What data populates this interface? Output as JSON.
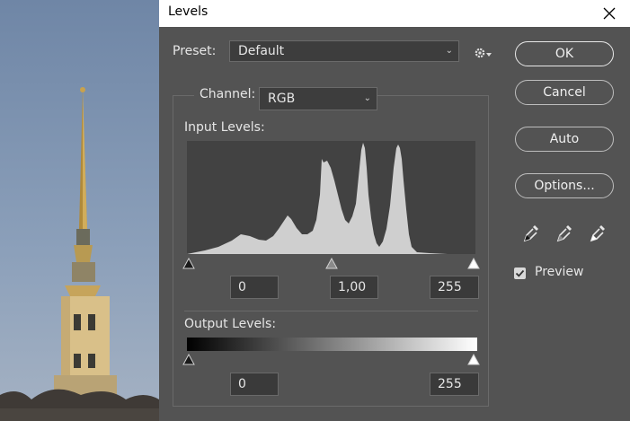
{
  "window": {
    "title": "Levels"
  },
  "preset": {
    "label": "Preset:",
    "value": "Default"
  },
  "channel": {
    "label": "Channel:",
    "value": "RGB"
  },
  "input_levels": {
    "label": "Input Levels:",
    "black": "0",
    "gamma": "1,00",
    "white": "255"
  },
  "output_levels": {
    "label": "Output Levels:",
    "black": "0",
    "white": "255"
  },
  "buttons": {
    "ok": "OK",
    "cancel": "Cancel",
    "auto": "Auto",
    "options": "Options..."
  },
  "preview": {
    "label": "Preview",
    "checked": true
  },
  "icons": {
    "close": "close-icon",
    "settings": "gear-icon",
    "eyedroppers": [
      "black-eyedropper-icon",
      "gray-eyedropper-icon",
      "white-eyedropper-icon"
    ]
  },
  "colors": {
    "dialog_bg": "#535353",
    "field_bg": "#3a3a3a",
    "histogram_bg": "#424242",
    "histogram_fill": "#cfcfcf"
  }
}
